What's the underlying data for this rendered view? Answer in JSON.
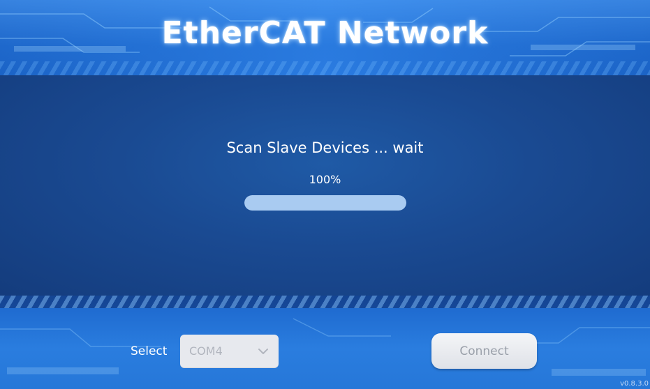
{
  "header": {
    "title": "EtherCAT  Network"
  },
  "main": {
    "status_text": "Scan Slave Devices ... wait",
    "progress_label": "100%",
    "progress_fraction": 1.0
  },
  "footer": {
    "select_label": "Select",
    "port_select": {
      "selected_value": "COM4"
    },
    "connect_label": "Connect",
    "version": "v0.8.3.0"
  },
  "colors": {
    "accent": "#2a7be0",
    "panel": "#1a4a92",
    "progress_fill": "#a9cbf1",
    "button_bg": "#e7e9ee"
  },
  "icons": {
    "select_chevron": "chevron-down-icon"
  }
}
